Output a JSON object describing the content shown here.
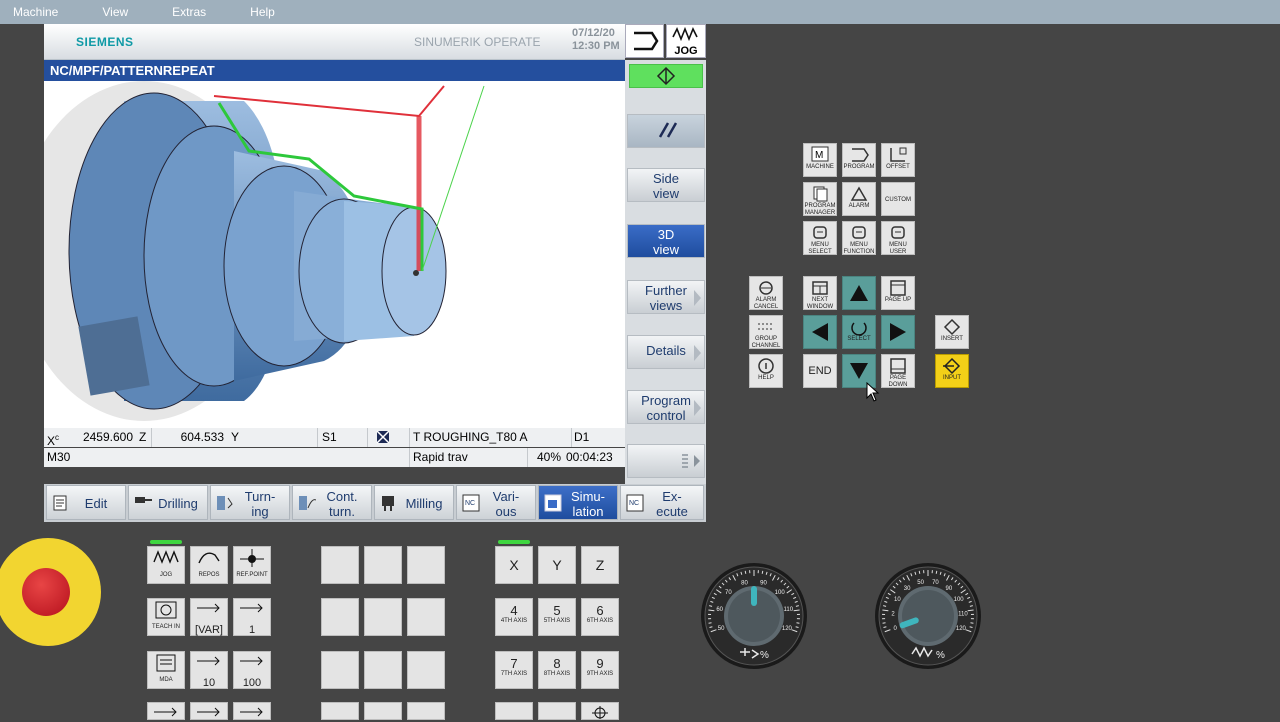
{
  "menubar": {
    "items": [
      "Machine",
      "View",
      "Extras",
      "Help"
    ]
  },
  "header": {
    "brand": "SIEMENS",
    "product": "SINUMERIK OPERATE",
    "date": "07/12/20",
    "time": "12:30 PM",
    "mode": "JOG"
  },
  "path": "NC/MPF/PATTERNREPEAT",
  "status_row1": {
    "x_label": "X",
    "x_sup": "c",
    "x_value": "2459.600",
    "z_label": "Z",
    "z_value": "604.533",
    "y_label": "Y",
    "spindle": "S1",
    "tool": "T ROUGHING_T80 A",
    "d": "D1"
  },
  "status_row2": {
    "mcode": "M30",
    "feed": "Rapid trav",
    "percent": "40%",
    "time": "00:04:23"
  },
  "vertical_softkeys": [
    {
      "label1": "Side",
      "label2": "view",
      "active": false
    },
    {
      "label1": "3D",
      "label2": "view",
      "active": true
    },
    {
      "label1": "Further",
      "label2": "views",
      "active": false
    },
    {
      "label1": "Details",
      "label2": "",
      "active": false
    },
    {
      "label1": "Program",
      "label2": "control",
      "active": false
    }
  ],
  "horizontal_softkeys": [
    {
      "label1": "Edit",
      "label2": "",
      "active": false
    },
    {
      "label1": "Drilling",
      "label2": "",
      "active": false
    },
    {
      "label1": "Turn-",
      "label2": "ing",
      "active": false
    },
    {
      "label1": "Cont.",
      "label2": "turn.",
      "active": false
    },
    {
      "label1": "Milling",
      "label2": "",
      "active": false
    },
    {
      "label1": "Vari-",
      "label2": "ous",
      "active": false
    },
    {
      "label1": "Simu-",
      "label2": "lation",
      "active": true
    },
    {
      "label1": "Ex-",
      "label2": "ecute",
      "active": false
    }
  ],
  "nc_badge": "NC",
  "keypad": {
    "machine": "MACHINE",
    "program": "PROGRAM",
    "offset": "OFFSET",
    "program_manager": "PROGRAM MANAGER",
    "alarm": "ALARM",
    "custom": "CUSTOM",
    "menu_select": "MENU SELECT",
    "menu_function": "MENU FUNCTION",
    "menu_user": "MENU USER",
    "alarm_cancel": "ALARM CANCEL",
    "next_window": "NEXT WINDOW",
    "page_up": "PAGE UP",
    "insert": "INSERT",
    "group_channel": "GROUP CHANNEL",
    "select": "SELECT",
    "help": "HELP",
    "end": "END",
    "page_down": "PAGE DOWN",
    "input": "INPUT"
  },
  "mcp": {
    "jog": "JOG",
    "repos": "REPOS",
    "ref_point": "REF.POINT",
    "teach_in": "TEACH IN",
    "var": "[VAR]",
    "inc1": "1",
    "mda": "MDA",
    "inc10": "10",
    "inc100": "100",
    "axis_x": "X",
    "axis_y": "Y",
    "axis_z": "Z",
    "k4": "4",
    "k4_sub": "4TH AXIS",
    "k5": "5",
    "k5_sub": "5TH AXIS",
    "k6": "6",
    "k6_sub": "6TH AXIS",
    "k7": "7",
    "k7_sub": "7TH AXIS",
    "k8": "8",
    "k8_sub": "8TH AXIS",
    "k9": "9",
    "k9_sub": "9TH AXIS"
  },
  "dials": {
    "spindle_ticks": [
      "50",
      "60",
      "70",
      "80",
      "90",
      "100",
      "110",
      "120"
    ],
    "spindle_label": "%",
    "feed_ticks": [
      "0",
      "2",
      "10",
      "30",
      "50",
      "70",
      "90",
      "100",
      "110",
      "120"
    ],
    "feed_label": "%",
    "spindle_value_pct": 50,
    "feed_value_pct": 0
  },
  "colors": {
    "panel_bg": "#454545",
    "header_blue": "#244f9e",
    "active_softkey": "#2a5db3",
    "teal_key": "#5a9e9a",
    "input_key": "#f3d018",
    "estop_red": "#d1202f",
    "estop_yellow": "#f2d530",
    "led_green": "#3fd640"
  }
}
